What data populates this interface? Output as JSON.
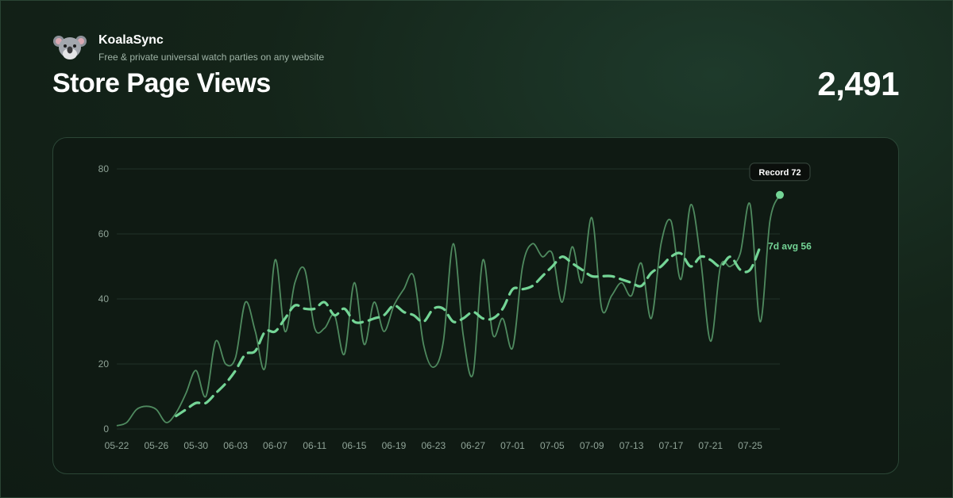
{
  "brand": {
    "name": "KoalaSync",
    "tagline": "Free & private universal watch parties on any website"
  },
  "page": {
    "title": "Store Page Views",
    "total": "2,491"
  },
  "colors": {
    "raw_line": "#4f8a5f",
    "avg_line": "#74d596",
    "record_dot": "#74d596"
  },
  "chart_data": {
    "type": "line",
    "ylim": [
      0,
      80
    ],
    "yticks": [
      0,
      20,
      40,
      60,
      80
    ],
    "x_tick_labels": [
      "05-22",
      "05-26",
      "05-30",
      "06-03",
      "06-07",
      "06-11",
      "06-15",
      "06-19",
      "06-23",
      "06-27",
      "07-01",
      "07-05",
      "07-09",
      "07-13",
      "07-17",
      "07-21",
      "07-25"
    ],
    "x_tick_every": 4,
    "series": [
      {
        "values": [
          1,
          2,
          6,
          7,
          6,
          2,
          5,
          11,
          18,
          10,
          27,
          20,
          22,
          39,
          30,
          19,
          52,
          30,
          45,
          49,
          31,
          31,
          35,
          23,
          45,
          26,
          39,
          30,
          38,
          43,
          47,
          26,
          19,
          27,
          57,
          29,
          17,
          52,
          29,
          34,
          25,
          50,
          57,
          53,
          54,
          39,
          56,
          45,
          65,
          37,
          41,
          45,
          41,
          51,
          34,
          57,
          64,
          46,
          69,
          52,
          27,
          50,
          50,
          54,
          69,
          33,
          64,
          72
        ]
      },
      {
        "name": "7d avg",
        "start_index": 6,
        "values": [
          4,
          6,
          8,
          8,
          11,
          14,
          18,
          23,
          24,
          30,
          30,
          34,
          38,
          37,
          37,
          39,
          35,
          37,
          33,
          33,
          34,
          35,
          38,
          36,
          35,
          33,
          37,
          37,
          33,
          34,
          36,
          34,
          34,
          37,
          43,
          43,
          44,
          47,
          50,
          53,
          51,
          49,
          47,
          47,
          47,
          46,
          45,
          44,
          48,
          50,
          53,
          54,
          50,
          53,
          52,
          50,
          53,
          49,
          49,
          56
        ]
      }
    ],
    "record": {
      "label": "Record",
      "value": 72
    },
    "avg_label": {
      "label": "7d avg",
      "value": 56
    }
  }
}
